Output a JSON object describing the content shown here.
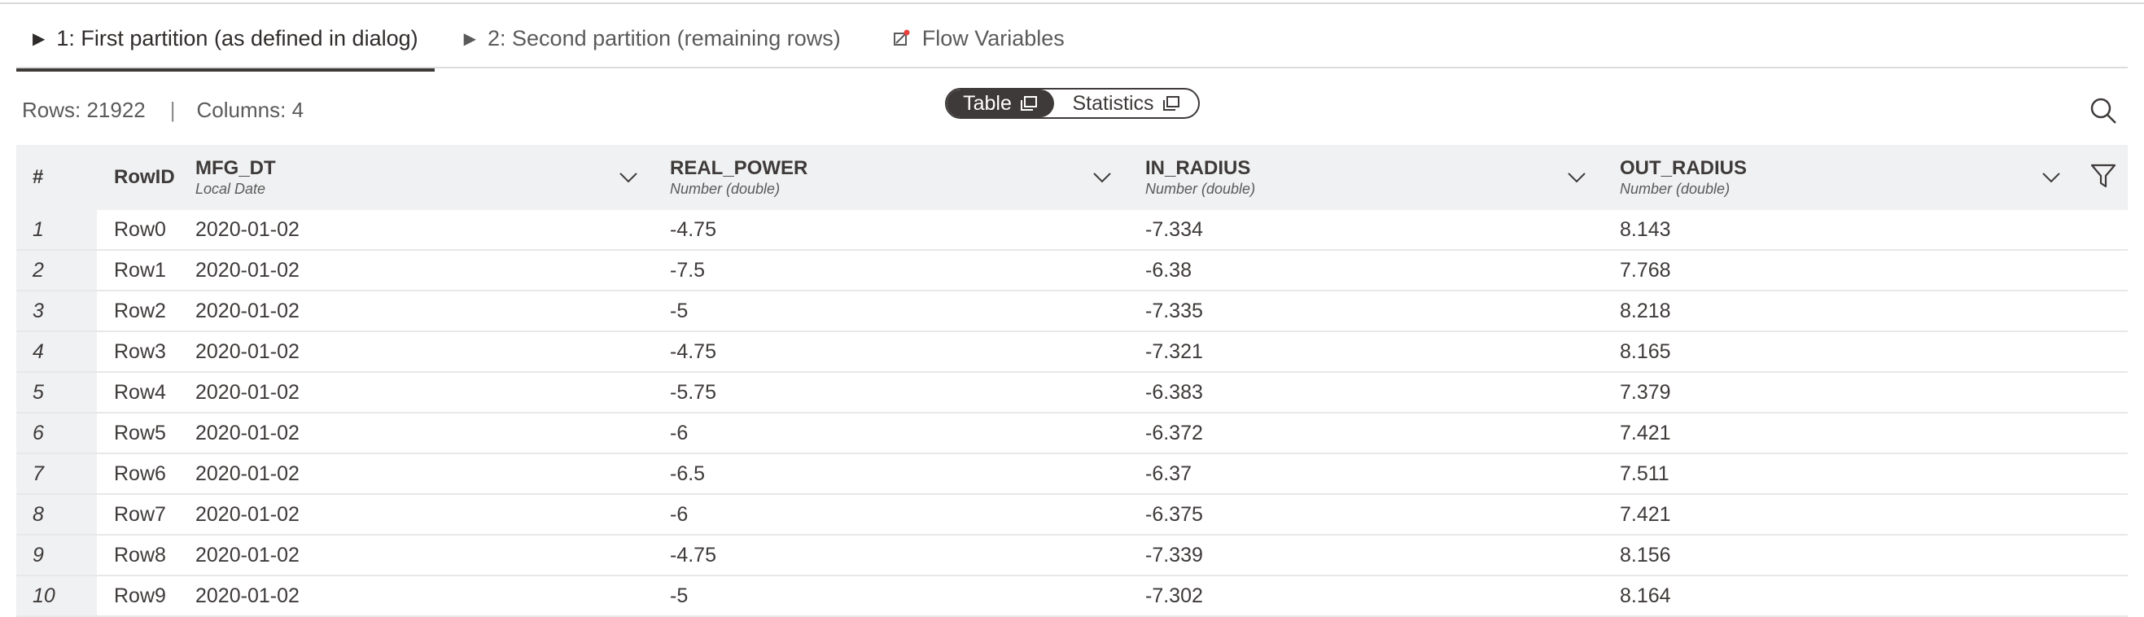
{
  "tabs": [
    {
      "label": "1: First partition (as defined in dialog)",
      "icon": "play-triangle-icon",
      "active": true
    },
    {
      "label": "2: Second partition (remaining rows)",
      "icon": "play-triangle-icon",
      "active": false
    },
    {
      "label": "Flow Variables",
      "icon": "flow-variable-icon",
      "active": false
    }
  ],
  "info": {
    "rows": "Rows: 21922",
    "separator": "|",
    "columns": "Columns: 4"
  },
  "view_toggle": {
    "table_label": "Table",
    "statistics_label": "Statistics",
    "selected": "Table"
  },
  "table": {
    "index_header": "#",
    "rowid_header": "RowID",
    "columns": [
      {
        "name": "MFG_DT",
        "type": "Local Date"
      },
      {
        "name": "REAL_POWER",
        "type": "Number (double)"
      },
      {
        "name": "IN_RADIUS",
        "type": "Number (double)"
      },
      {
        "name": "OUT_RADIUS",
        "type": "Number (double)"
      }
    ],
    "rows": [
      {
        "idx": "1",
        "rowid": "Row0",
        "cells": [
          "2020-01-02",
          "-4.75",
          "-7.334",
          "8.143"
        ]
      },
      {
        "idx": "2",
        "rowid": "Row1",
        "cells": [
          "2020-01-02",
          "-7.5",
          "-6.38",
          "7.768"
        ]
      },
      {
        "idx": "3",
        "rowid": "Row2",
        "cells": [
          "2020-01-02",
          "-5",
          "-7.335",
          "8.218"
        ]
      },
      {
        "idx": "4",
        "rowid": "Row3",
        "cells": [
          "2020-01-02",
          "-4.75",
          "-7.321",
          "8.165"
        ]
      },
      {
        "idx": "5",
        "rowid": "Row4",
        "cells": [
          "2020-01-02",
          "-5.75",
          "-6.383",
          "7.379"
        ]
      },
      {
        "idx": "6",
        "rowid": "Row5",
        "cells": [
          "2020-01-02",
          "-6",
          "-6.372",
          "7.421"
        ]
      },
      {
        "idx": "7",
        "rowid": "Row6",
        "cells": [
          "2020-01-02",
          "-6.5",
          "-6.37",
          "7.511"
        ]
      },
      {
        "idx": "8",
        "rowid": "Row7",
        "cells": [
          "2020-01-02",
          "-6",
          "-6.375",
          "7.421"
        ]
      },
      {
        "idx": "9",
        "rowid": "Row8",
        "cells": [
          "2020-01-02",
          "-4.75",
          "-7.339",
          "8.156"
        ]
      },
      {
        "idx": "10",
        "rowid": "Row9",
        "cells": [
          "2020-01-02",
          "-5",
          "-7.302",
          "8.164"
        ]
      }
    ]
  },
  "colors": {
    "accent": "#3e3a39",
    "header_bg": "#f0f1f2",
    "flow_dot": "#e8403b"
  }
}
